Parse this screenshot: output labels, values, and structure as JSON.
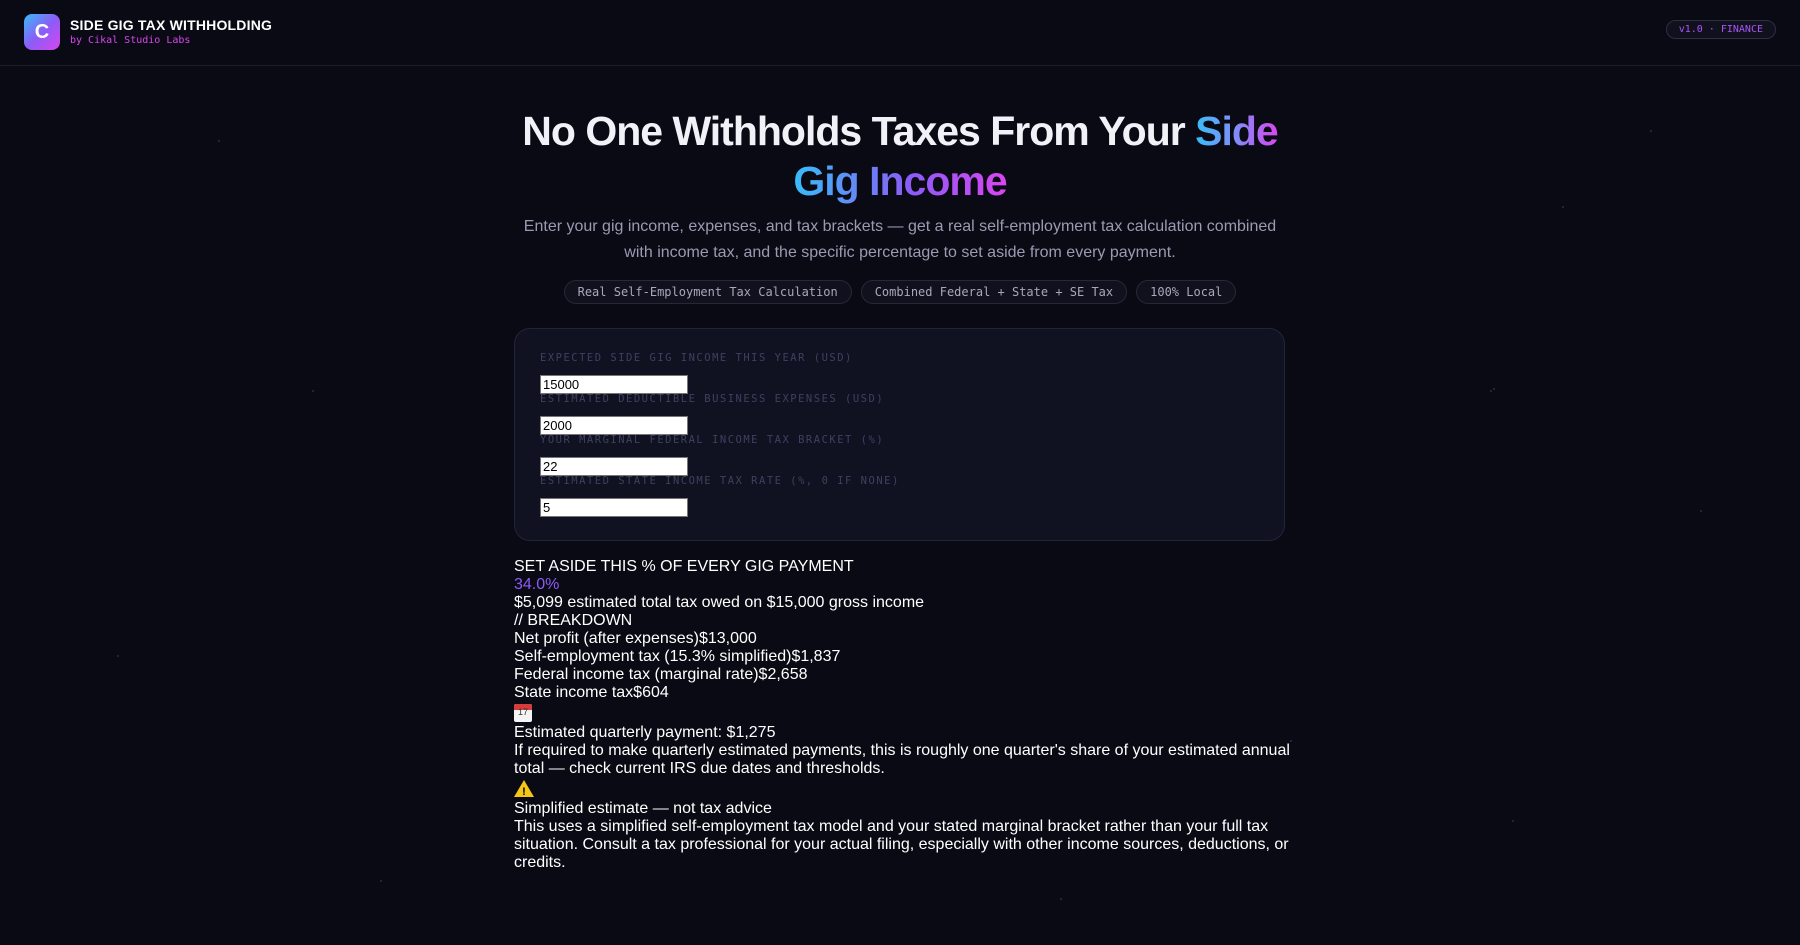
{
  "header": {
    "logo_letter": "C",
    "title": "SIDE GIG TAX WITHHOLDING",
    "subtitle": "by Cikal Studio Labs",
    "version_badge": "v1.0 · FINANCE"
  },
  "hero": {
    "title_plain": "No One Withholds Taxes From Your",
    "title_accent_1": "Side",
    "title_accent_2": "Gig Income",
    "description": "Enter your gig income, expenses, and tax brackets — get a real self-employment tax calculation combined with income tax, and the specific percentage to set aside from every payment.",
    "chips": [
      "Real Self-Employment Tax Calculation",
      "Combined Federal + State + SE Tax",
      "100% Local"
    ]
  },
  "form": {
    "income_label": "EXPECTED SIDE GIG INCOME THIS YEAR (USD)",
    "income_value": "15000",
    "expenses_label": "ESTIMATED DEDUCTIBLE BUSINESS EXPENSES (USD)",
    "expenses_value": "2000",
    "federal_label": "YOUR MARGINAL FEDERAL INCOME TAX BRACKET (%)",
    "federal_value": "22",
    "state_label": "ESTIMATED STATE INCOME TAX RATE (%, 0 IF NONE)",
    "state_value": "5"
  },
  "results": {
    "set_aside_label": "SET ASIDE THIS % OF EVERY GIG PAYMENT",
    "set_aside_percent": "34.0%",
    "total_summary": "$5,099 estimated total tax owed on $15,000 gross income",
    "breakdown_heading": "// BREAKDOWN",
    "breakdown": [
      {
        "label": "Net profit (after expenses)",
        "value": "$13,000"
      },
      {
        "label": "Self-employment tax (15.3% simplified)",
        "value": "$1,837"
      },
      {
        "label": "Federal income tax (marginal rate)",
        "value": "$2,658"
      },
      {
        "label": "State income tax",
        "value": "$604"
      }
    ],
    "calendar_icon": "calendar-icon",
    "calendar_day": "17",
    "quarterly_title": "Estimated quarterly payment: $1,275",
    "quarterly_text": "If required to make quarterly estimated payments, this is roughly one quarter's share of your estimated annual total — check current IRS due dates and thresholds.",
    "warning_icon": "warning-icon",
    "disclaimer_title": "Simplified estimate — not tax advice",
    "disclaimer_text": "This uses a simplified self-employment tax model and your stated marginal bracket rather than your full tax situation. Consult a tax professional for your actual filing, especially with other income sources, deductions, or credits."
  },
  "colors": {
    "background": "#0a0a14",
    "accent_purple": "#8b5cf6",
    "accent_cyan": "#38bdf8",
    "accent_magenta": "#d946ef"
  }
}
